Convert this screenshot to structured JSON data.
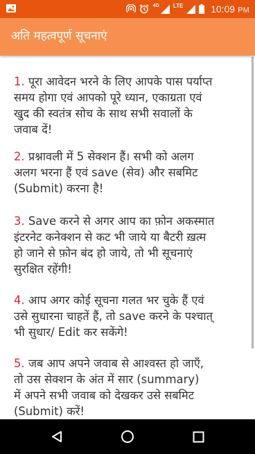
{
  "status_bar": {
    "time": "10:09",
    "ampm": "PM",
    "network_label": "LTE",
    "network_small": "4G",
    "icons": [
      "image-icon",
      "hotspot-icon",
      "alarm-icon",
      "signal-icon",
      "battery-icon"
    ]
  },
  "app_bar": {
    "title": "अति महत्वपूर्ण सूचनाएं"
  },
  "notices": [
    {
      "number": "1.",
      "lines": [
        "पूरा आवेदन भरने के लिए आपके पास पर्याप्त",
        "समय होगा एवं आपको पूरे ध्यान, एकाग्रता एवं",
        "खुद की स्वतंत्र सोच के साथ सभी सवालों के",
        "जवाब दें!"
      ]
    },
    {
      "number": "2.",
      "lines": [
        "प्रश्नावली में 5 सेक्शन हैं। सभी को अलग",
        "अलग भरना हैं एवं save (सेव) और सबमिट",
        "(Submit) करना है!"
      ]
    },
    {
      "number": "3.",
      "lines": [
        "Save करने से अगर आप का फ़ोन अकस्मात",
        "इंटरनेट कनेक्शन से कट भी जाये या बैटरी ख़त्म",
        "हो जाने से फ़ोन बंद हो जाये, तो भी सूचनाएं",
        "सुरक्षित रहेंगी!"
      ]
    },
    {
      "number": "4.",
      "lines": [
        "आप अगर कोई सूचना गलत भर चुके हैं एवं",
        "उसे सुधारना चाहतें हैं, तो save करने के पश्चात्",
        "भी सुधार/ Edit कर सकेंगे!"
      ]
    },
    {
      "number": "5.",
      "lines": [
        "जब आप अपने जवाब से आश्वस्त हो जाएँ,",
        "तो उस सेक्शन के अंत में सार (summary)",
        "में अपने सभी जवाब को देखकर उसे सबमिट",
        "(Submit) करें!"
      ]
    }
  ],
  "nav_bar": {
    "buttons": [
      "back-icon",
      "home-icon",
      "recents-icon"
    ]
  },
  "colors": {
    "status_bar": "#e8550e",
    "app_bar": "#f7904e",
    "number_red": "#d7262b",
    "text": "#333333",
    "nav_bar": "#000000"
  }
}
